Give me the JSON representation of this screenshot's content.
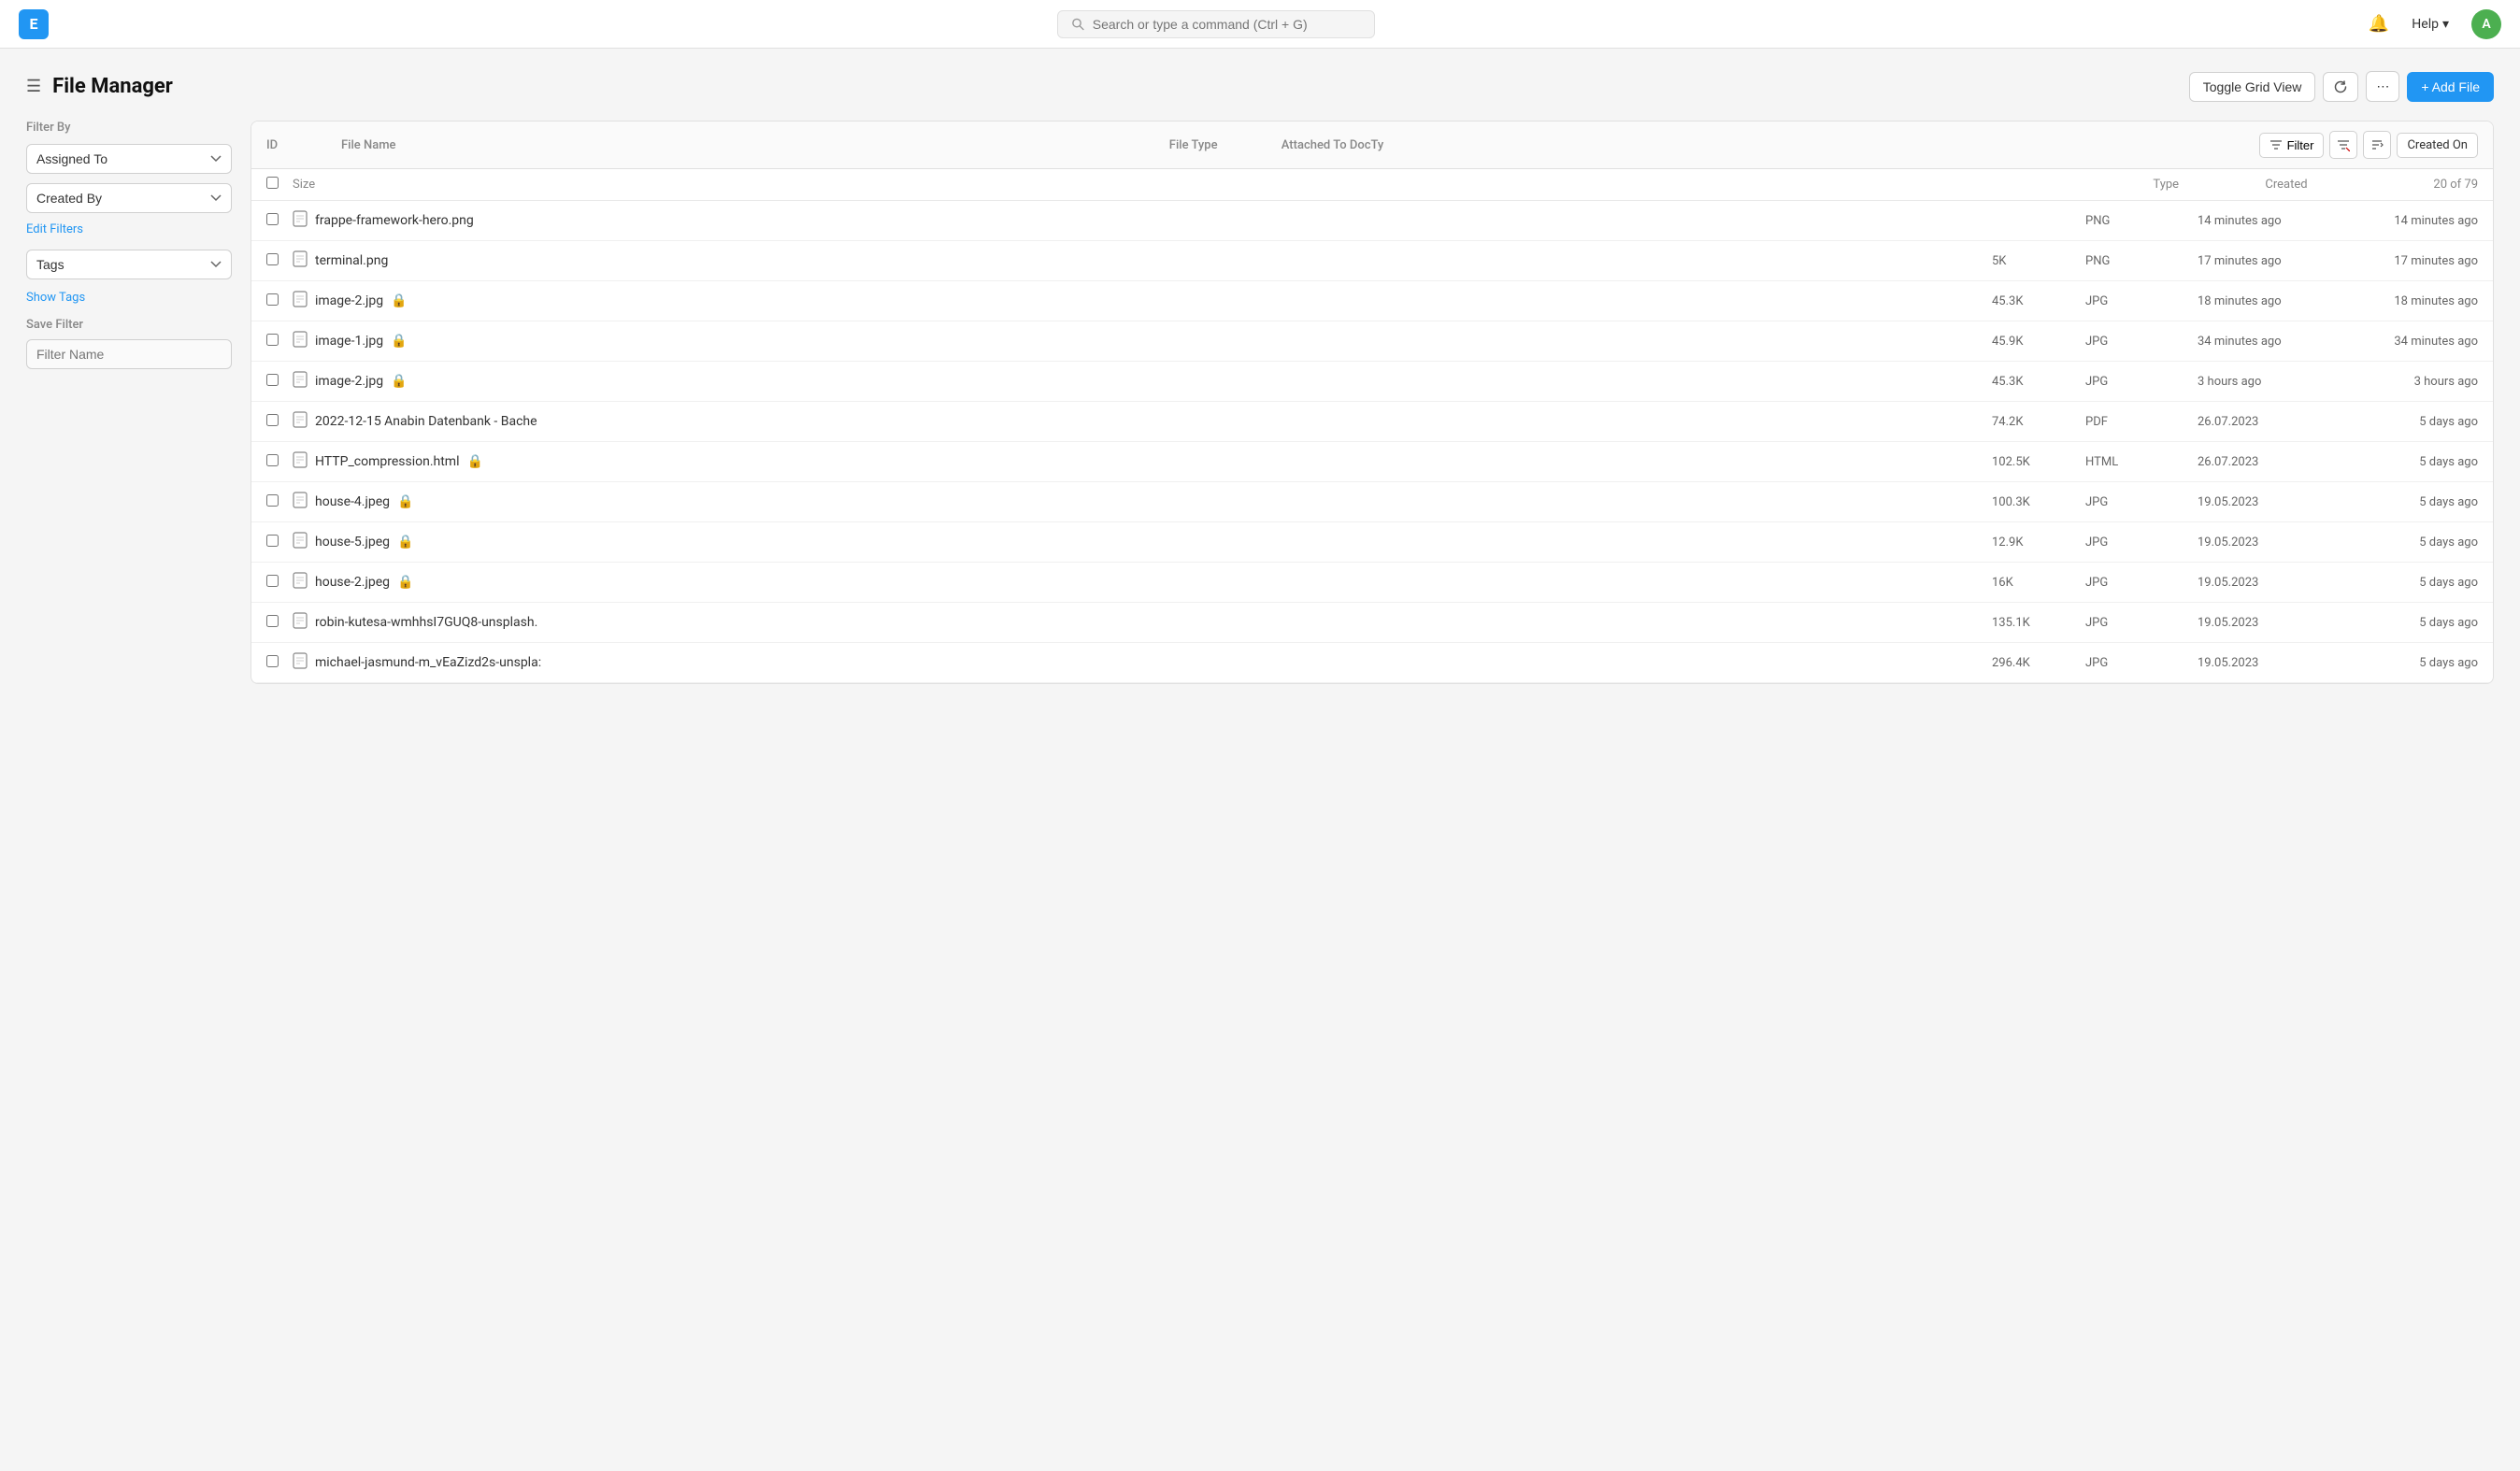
{
  "topnav": {
    "logo_letter": "E",
    "search_placeholder": "Search or type a command (Ctrl + G)",
    "help_label": "Help",
    "avatar_letter": "A"
  },
  "page": {
    "title": "File Manager",
    "actions": {
      "toggle_grid_view": "Toggle Grid View",
      "refresh_label": "↻",
      "more_label": "⋯",
      "add_file_label": "+ Add File"
    }
  },
  "sidebar": {
    "filter_by_label": "Filter By",
    "assigned_to_option": "Assigned To",
    "created_by_option": "Created By",
    "edit_filters_label": "Edit Filters",
    "tags_option": "Tags",
    "show_tags_label": "Show Tags",
    "save_filter_label": "Save Filter",
    "filter_name_placeholder": "Filter Name"
  },
  "table": {
    "columns": {
      "id": "ID",
      "file_name": "File Name",
      "file_type": "File Type",
      "attached_to": "Attached To DocTy",
      "filter_btn": "Filter",
      "created_on_col": "Created On"
    },
    "sub_headers": {
      "size": "Size",
      "type": "Type",
      "created": "Created",
      "pagination": "20 of 79"
    },
    "rows": [
      {
        "id": "",
        "filename": "frappe-framework-hero.png",
        "size": "",
        "type": "PNG",
        "created": "14 minutes ago",
        "created_on": "14 minutes ago",
        "locked": false
      },
      {
        "id": "",
        "filename": "terminal.png",
        "size": "5K",
        "type": "PNG",
        "created": "17 minutes ago",
        "created_on": "17 minutes ago",
        "locked": false
      },
      {
        "id": "",
        "filename": "image-2.jpg",
        "size": "45.3K",
        "type": "JPG",
        "created": "18 minutes ago",
        "created_on": "18 minutes ago",
        "locked": true
      },
      {
        "id": "",
        "filename": "image-1.jpg",
        "size": "45.9K",
        "type": "JPG",
        "created": "34 minutes ago",
        "created_on": "34 minutes ago",
        "locked": true
      },
      {
        "id": "",
        "filename": "image-2.jpg",
        "size": "45.3K",
        "type": "JPG",
        "created": "3 hours ago",
        "created_on": "3 hours ago",
        "locked": true
      },
      {
        "id": "",
        "filename": "2022-12-15 Anabin Datenbank - Bache",
        "size": "74.2K",
        "type": "PDF",
        "created": "26.07.2023",
        "created_on": "5 days ago",
        "locked": false
      },
      {
        "id": "",
        "filename": "HTTP_compression.html",
        "size": "102.5K",
        "type": "HTML",
        "created": "26.07.2023",
        "created_on": "5 days ago",
        "locked": true
      },
      {
        "id": "",
        "filename": "house-4.jpeg",
        "size": "100.3K",
        "type": "JPG",
        "created": "19.05.2023",
        "created_on": "5 days ago",
        "locked": true
      },
      {
        "id": "",
        "filename": "house-5.jpeg",
        "size": "12.9K",
        "type": "JPG",
        "created": "19.05.2023",
        "created_on": "5 days ago",
        "locked": true
      },
      {
        "id": "",
        "filename": "house-2.jpeg",
        "size": "16K",
        "type": "JPG",
        "created": "19.05.2023",
        "created_on": "5 days ago",
        "locked": true
      },
      {
        "id": "",
        "filename": "robin-kutesa-wmhhsI7GUQ8-unsplash.",
        "size": "135.1K",
        "type": "JPG",
        "created": "19.05.2023",
        "created_on": "5 days ago",
        "locked": false
      },
      {
        "id": "",
        "filename": "michael-jasmund-m_vEaZizd2s-unspla:",
        "size": "296.4K",
        "type": "JPG",
        "created": "19.05.2023",
        "created_on": "5 days ago",
        "locked": false
      }
    ]
  }
}
